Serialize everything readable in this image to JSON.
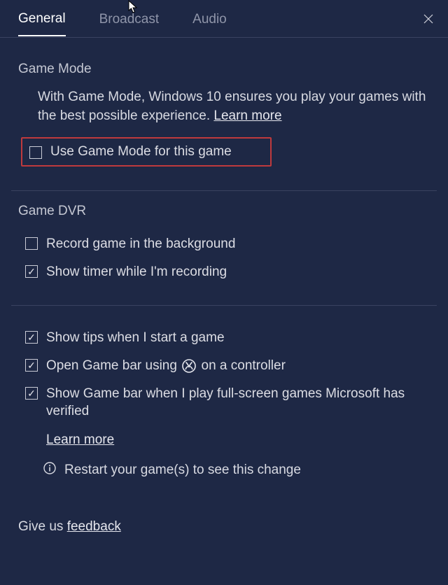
{
  "tabs": {
    "general": "General",
    "broadcast": "Broadcast",
    "audio": "Audio"
  },
  "gamemode": {
    "title": "Game Mode",
    "desc_before": "With Game Mode, Windows 10 ensures you play your games with the best possible experience. ",
    "learn_more": "Learn more",
    "checkbox_label": "Use Game Mode for this game"
  },
  "dvr": {
    "title": "Game DVR",
    "record_bg": "Record game in the background",
    "show_timer": "Show timer while I'm recording"
  },
  "misc": {
    "show_tips": "Show tips when I start a game",
    "open_gamebar_before": "Open Game bar using",
    "open_gamebar_after": "on a controller",
    "show_fullscreen": "Show Game bar when I play full-screen games Microsoft has verified",
    "learn_more": "Learn more",
    "restart_note": "Restart your game(s) to see this change"
  },
  "footer": {
    "give_us": "Give us ",
    "feedback": "feedback"
  }
}
